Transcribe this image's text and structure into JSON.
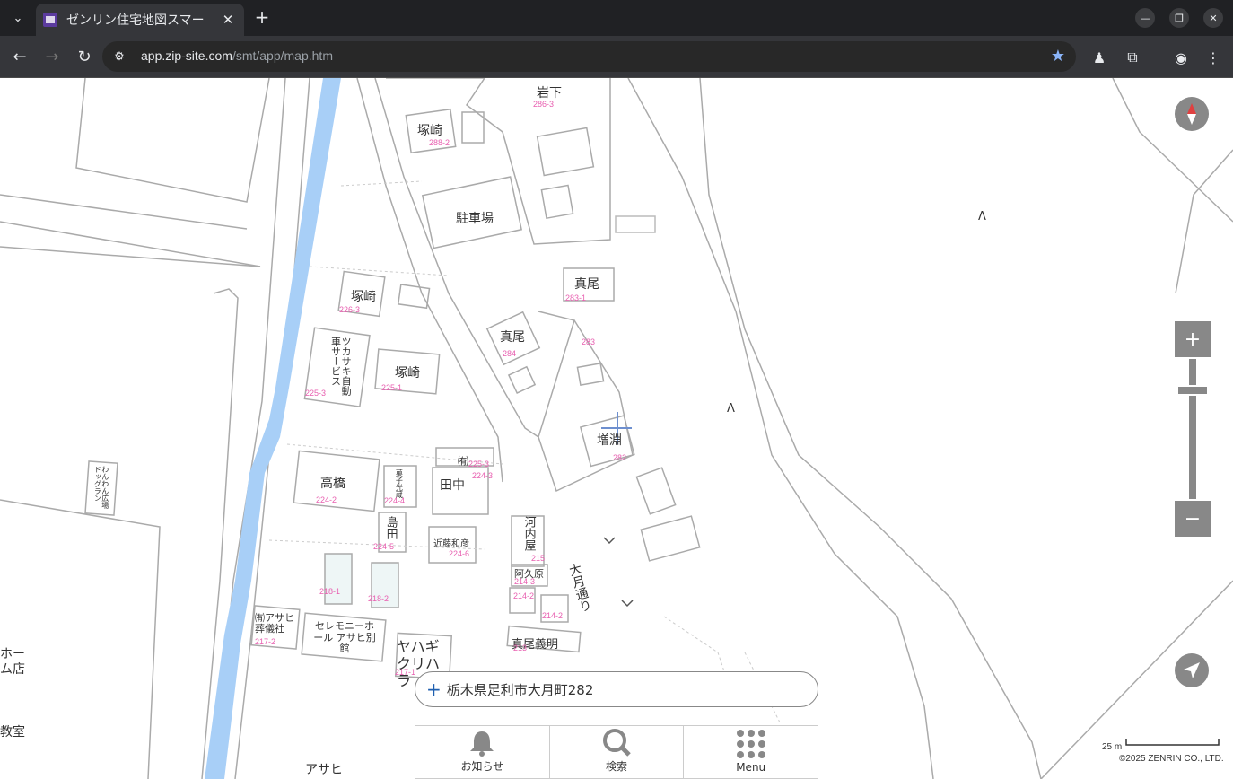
{
  "browser": {
    "tab_title": "ゼンリン住宅地図スマー",
    "url_host": "app.zip-site.com",
    "url_path": "/smt/app/map.htm"
  },
  "map": {
    "search_address": "栃木県足利市大月町282",
    "menu": [
      {
        "label": "お知らせ",
        "icon": "bell-icon"
      },
      {
        "label": "検索",
        "icon": "search-icon"
      },
      {
        "label": "Menu",
        "icon": "grid-menu-icon"
      }
    ],
    "scale_label": "25 m",
    "copyright": "©2025 ZENRIN CO., LTD.",
    "labels": {
      "iwashita": "岩下",
      "iwashita_num": "286-3",
      "tsukazaki1": "塚崎",
      "tsukazaki1_num": "288-2",
      "parking": "駐車場",
      "mao1": "真尾",
      "mao1_num": "283-1",
      "tsukazaki2": "塚崎",
      "tsukazaki2_num": "226-3",
      "mao2": "真尾",
      "mao2_num": "284",
      "num_283": "283",
      "tsukasaki_auto": "ツカサキ自動車サービス",
      "tsukasaki_auto_num": "225-3",
      "tsukazaki3": "塚崎",
      "tsukazaki3_num": "225-1",
      "masubuchi": "増淵",
      "masubuchi_num": "282",
      "yu": "㈲",
      "yu_num": "225-3",
      "takahashi": "高橋",
      "takahashi_num": "224-2",
      "kashiya": "菓子光蔵",
      "kashiya_num": "224-4",
      "tanaka": "田中",
      "tanaka_num": "224-3",
      "shimada": "島田",
      "shimada_num": "224-5",
      "kondo": "近藤和彦",
      "kondo_num": "224-6",
      "kawachiya": "河内屋",
      "kawachiya_num": "215",
      "akuhara": "阿久原",
      "akuhara_num": "214-3",
      "num_214_2a": "214-2",
      "num_214_2b": "214-2",
      "otsuki_dori": "大月通り",
      "num_218_1": "218-1",
      "num_218_2": "218-2",
      "asahi_sogi": "㈲アサヒ葬儀社",
      "asahi_sogi_num": "217-2",
      "ceremony": "セレモニーホール アサヒ別館",
      "yahagi": "ヤハギクリハラ",
      "yahagi_num": "217-1",
      "mao_yoshiaki": "真尾義明",
      "mao_yoshiaki_num": "213",
      "home_store": "ホーム店",
      "classroom": "教室",
      "asahi_bottom": "アサヒ",
      "wanwan": "わんわん広場ドッグラン",
      "mountain1": "Λ",
      "mountain2": "Λ"
    }
  }
}
